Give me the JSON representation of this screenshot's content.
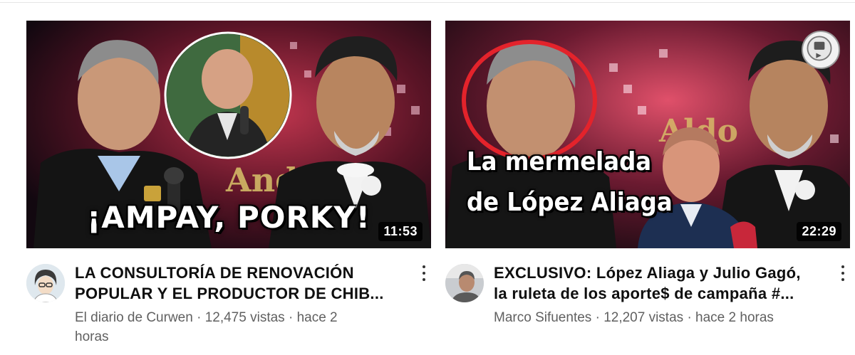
{
  "videos": [
    {
      "duration": "11:53",
      "overlay_text": "¡AMPAY, PORKY!",
      "title_line1": "LA CONSULTORÍA DE RENOVACIÓN",
      "title_line2": "POPULAR Y EL PRODUCTOR DE CHIB...",
      "channel": "El diario de Curwen",
      "views": "12,475 vistas",
      "separator": "·",
      "age": "hace 2",
      "age_line2": "horas"
    },
    {
      "duration": "22:29",
      "overlay_line1": "La mermelada",
      "overlay_line2": "de López Aliaga",
      "title_line1": "EXCLUSIVO: López Aliaga y Julio Gagó,",
      "title_line2": "la ruleta de los aporte$ de campaña #...",
      "channel": "Marco Sifuentes",
      "views": "12,207 vistas",
      "separator": "·",
      "age": "hace 2 horas"
    }
  ],
  "icons": {
    "more": "kebab-menu-icon",
    "avatar": "channel-avatar"
  }
}
